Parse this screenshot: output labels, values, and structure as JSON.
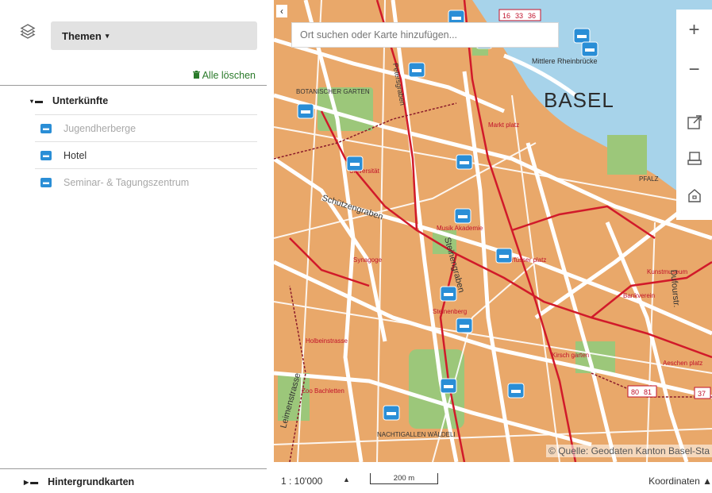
{
  "sidebar": {
    "themen_label": "Themen",
    "themen_caret": "▾",
    "clear_all_label": "Alle löschen",
    "group": {
      "label": "Unterkünfte",
      "expanded_glyph": "▾"
    },
    "layers": [
      {
        "label": "Jugendherberge",
        "active": false
      },
      {
        "label": "Hotel",
        "active": true
      },
      {
        "label": "Seminar- & Tagungszentrum",
        "active": false
      }
    ],
    "background_maps_label": "Hintergrundkarten"
  },
  "map": {
    "search_placeholder": "Ort suchen oder Karte hinzufügen...",
    "city_label": "BASEL",
    "attribution": "© Quelle: Geodaten Kanton Basel-Sta",
    "place_labels": [
      "BOTANISCHER GARTEN",
      "Universität",
      "Musik Akademie",
      "Barfüsser platz",
      "Markt platz",
      "NACHTIGALLEN WÄLDELI",
      "Zoo Bachletten",
      "PFALZ",
      "Kirsch garten",
      "Steinenberg",
      "Kunstmuseum",
      "Mittlere Rheinbrücke",
      "Holbeinstrasse",
      "Synagoge",
      "Bankverein",
      "Aeschen platz"
    ],
    "street_labels": [
      "Schützengraben",
      "Leimenstrasse",
      "Steinengraben",
      "Petersgraben",
      "Dufourstr."
    ],
    "route_badges": [
      "16",
      "33",
      "36",
      "80",
      "81",
      "37"
    ],
    "colors": {
      "blocks": "#e9a86a",
      "streets": "#ffffff",
      "parks": "#9cc77a",
      "water": "#a7d3ea",
      "route": "#d11a2a",
      "tram": "#8a1a2a",
      "hotel_marker": "#2a8ed6"
    },
    "icons": [
      "layers-icon",
      "zoom-in-icon",
      "zoom-out-icon",
      "share-icon",
      "print-icon",
      "home-icon",
      "hotel-icon"
    ]
  },
  "toolbar": {
    "zoom_in": "+",
    "zoom_out": "−"
  },
  "bottom": {
    "scale": "1 : 10'000",
    "scale_caret": "▲",
    "scalebar_label": "200 m",
    "coords_label": "Koordinaten ▲"
  },
  "collapse_glyph": "‹"
}
